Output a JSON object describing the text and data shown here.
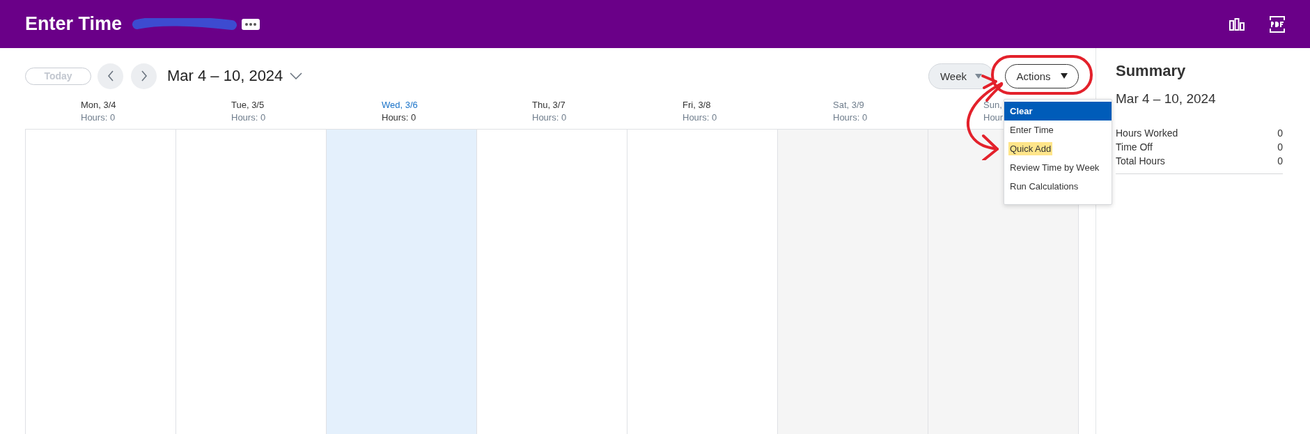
{
  "header": {
    "title": "Enter Time"
  },
  "toolbar": {
    "today_button": {
      "label": "Today",
      "disabled": true
    },
    "date_range": "Mar 4 – 10, 2024",
    "view_select": "Week",
    "actions_button": "Actions"
  },
  "days": [
    {
      "label": "Mon, 3/4",
      "hours": "Hours: 0",
      "selected": false,
      "weekend": false
    },
    {
      "label": "Tue, 3/5",
      "hours": "Hours: 0",
      "selected": false,
      "weekend": false
    },
    {
      "label": "Wed, 3/6",
      "hours": "Hours: 0",
      "selected": true,
      "weekend": false
    },
    {
      "label": "Thu, 3/7",
      "hours": "Hours: 0",
      "selected": false,
      "weekend": false
    },
    {
      "label": "Fri, 3/8",
      "hours": "Hours: 0",
      "selected": false,
      "weekend": false
    },
    {
      "label": "Sat, 3/9",
      "hours": "Hours: 0",
      "selected": false,
      "weekend": true
    },
    {
      "label": "Sun,",
      "hours": "Hour",
      "selected": false,
      "weekend": true
    }
  ],
  "actions_menu": [
    {
      "label": "Clear",
      "selected": true,
      "highlighted": false
    },
    {
      "label": "Enter Time",
      "selected": false,
      "highlighted": false
    },
    {
      "label": "Quick Add",
      "selected": false,
      "highlighted": true
    },
    {
      "label": "Review Time by Week",
      "selected": false,
      "highlighted": false
    },
    {
      "label": "Run Calculations",
      "selected": false,
      "highlighted": false
    }
  ],
  "summary": {
    "title": "Summary",
    "date_range": "Mar 4 – 10, 2024",
    "rows": [
      {
        "label": "Hours Worked",
        "value": "0"
      },
      {
        "label": "Time Off",
        "value": "0"
      },
      {
        "label": "Total Hours",
        "value": "0"
      }
    ]
  }
}
